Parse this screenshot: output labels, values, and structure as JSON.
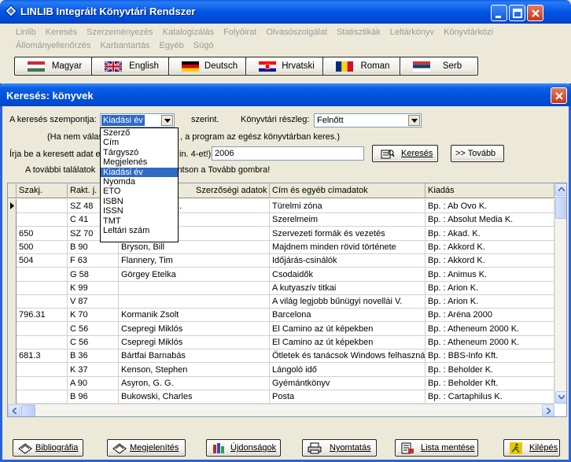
{
  "app": {
    "title": "LINLIB Integrált Könyvtári Rendszer"
  },
  "menu": [
    "Linlib",
    "Keresés",
    "Szerzeményezés",
    "Katalogizálás",
    "Folyóirat",
    "Olvasószolgálat",
    "Statisztikák",
    "Leltárkönyv",
    "Könyvtárközi",
    "Állományellenőrzés",
    "Karbantartás",
    "Egyéb",
    "Súgó"
  ],
  "languages": [
    {
      "label": "Magyar",
      "flag": "hu"
    },
    {
      "label": "English",
      "flag": "uk"
    },
    {
      "label": "Deutsch",
      "flag": "de"
    },
    {
      "label": "Hrvatski",
      "flag": "hr"
    },
    {
      "label": "Roman",
      "flag": "ro"
    },
    {
      "label": "Serb",
      "flag": "rs"
    }
  ],
  "search": {
    "title": "Keresés: könyvek",
    "criterion_label": "A keresés szempontja:",
    "criterion_value": "Kiadási év",
    "by_label": "szerint.",
    "section_label": "Könyvtári részleg:",
    "section_value": "Felnőtt",
    "hint_1": "(Ha nem válas",
    "hint_1b": ", a program az egész könyvtárban keres.)",
    "prompt": "Írja be a keresett adat el",
    "prompt_b": "in. 4-et!):",
    "query_value": "2006",
    "search_button": "Keresés",
    "next_button": ">> Tovább",
    "more_hint": "A további találatok",
    "more_hint_b": "intson a Tovább gombra!"
  },
  "dropdown_options": [
    "Szerző",
    "Cím",
    "Tárgyszó",
    "Megjelenés",
    "Kiadási év",
    "Nyomda",
    "ETO",
    "ISBN",
    "ISSN",
    "TMT",
    "Leltári szám"
  ],
  "dropdown_selected": "Kiadási év",
  "table": {
    "headers": [
      "Szakj.",
      "Rakt. j.",
      "Szerzőségi adatok",
      "Cím és egyéb címadatok",
      "Kiadás"
    ],
    "rows": [
      [
        "",
        "SZ 48",
        "Ervin Lászla, R.",
        "Türelmi zóna",
        "Bp. : Ab Ovo K."
      ],
      [
        "",
        "C 41",
        "",
        "Szerelmeim",
        "Bp. : Absolut Media K."
      ],
      [
        "650",
        "SZ 70",
        "",
        "Szervezeti formák és vezetés",
        "Bp. : Akad. K."
      ],
      [
        "500",
        "B 90",
        "Bryson, Bill",
        "Majdnem minden rövid története",
        "Bp. : Akkord K."
      ],
      [
        "504",
        "F 63",
        "Flannery, Tim",
        "Időjárás-csinálók",
        "Bp. : Akkord K."
      ],
      [
        "",
        "G 58",
        "Görgey Etelka",
        "Csodaidők",
        "Bp. : Animus K."
      ],
      [
        "",
        "K 99",
        "",
        "A kutyaszív titkai",
        "Bp. : Arion K."
      ],
      [
        "",
        "V 87",
        "",
        "A világ legjobb bűnügyi novellái V.",
        "Bp. : Arion K."
      ],
      [
        "796.31",
        "K 70",
        "Kormanik Zsolt",
        "Barcelona",
        "Bp. : Aréna 2000"
      ],
      [
        "",
        "C 56",
        "Csepregi Miklós",
        "El Camino az út képekben",
        "Bp. : Atheneum 2000 K."
      ],
      [
        "",
        "C 56",
        "Csepregi Miklós",
        "El Camino az út képekben",
        "Bp. : Atheneum 2000 K."
      ],
      [
        "681.3",
        "B 36",
        "Bártfai Barnabás",
        "Ötletek és tanácsok Windows felhasználóknak",
        "Bp. : BBS-Info Kft."
      ],
      [
        "",
        "K 37",
        "Kenson, Stephen",
        "Lángoló idő",
        "Bp. : Beholder K."
      ],
      [
        "",
        "A 90",
        "Asyron, G. G.",
        "Gyémántkönyv",
        "Bp. : Beholder Kft."
      ],
      [
        "",
        "B 96",
        "Bukowski, Charles",
        "Posta",
        "Bp. : Cartaphilus K."
      ]
    ]
  },
  "bottom_buttons": [
    {
      "label": "Bibliográfia",
      "icon": "bibliography-icon"
    },
    {
      "label": "Megjelenítés",
      "icon": "display-icon"
    },
    {
      "label": "Újdonságok",
      "icon": "news-icon"
    },
    {
      "label": "Nyomtatás",
      "icon": "print-icon"
    },
    {
      "label": "Lista mentése",
      "icon": "save-list-icon"
    },
    {
      "label": "Kilépés",
      "icon": "exit-icon"
    }
  ]
}
